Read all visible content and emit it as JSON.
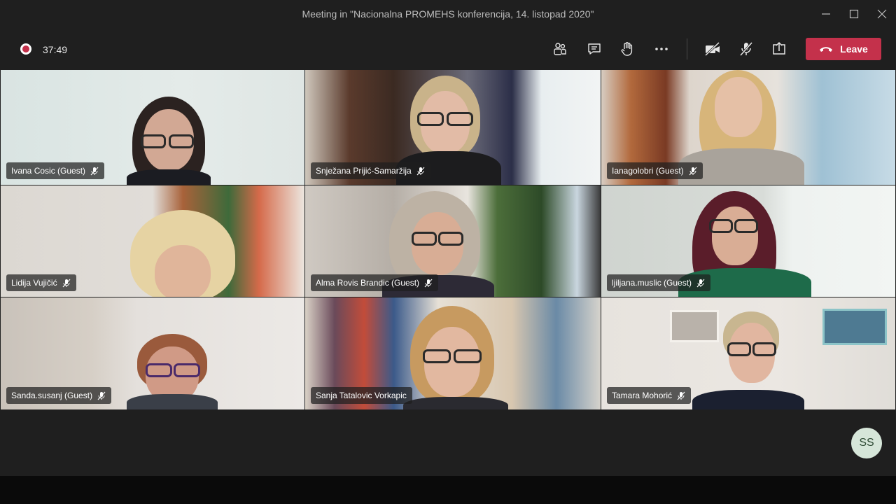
{
  "window": {
    "title": "Meeting in \"Nacionalna PROMEHS konferencija, 14. listopad 2020\""
  },
  "toolbar": {
    "timer": "37:49",
    "leave_label": "Leave",
    "colors": {
      "leave": "#c4314b",
      "recording": "#c4314b"
    },
    "icons": [
      "participants-icon",
      "chat-icon",
      "raise-hand-icon",
      "more-options-icon",
      "camera-off-icon",
      "mic-off-icon",
      "share-screen-icon",
      "hangup-icon"
    ]
  },
  "participants": [
    {
      "name": "Ivana Cosic (Guest)",
      "muted": true
    },
    {
      "name": "Snježana Prijić-Samaržija",
      "muted": true
    },
    {
      "name": "Ianagolobri (Guest)",
      "muted": true
    },
    {
      "name": "Lidija Vujičić",
      "muted": true
    },
    {
      "name": "Alma Rovis Brandic (Guest)",
      "muted": true
    },
    {
      "name": "ljiljana.muslic (Guest)",
      "muted": true
    },
    {
      "name": "Sanda.susanj (Guest)",
      "muted": true
    },
    {
      "name": "Sanja Tatalovic Vorkapic",
      "muted": false
    },
    {
      "name": "Tamara Mohorić",
      "muted": true
    }
  ],
  "self_avatar": {
    "initials": "SS"
  }
}
